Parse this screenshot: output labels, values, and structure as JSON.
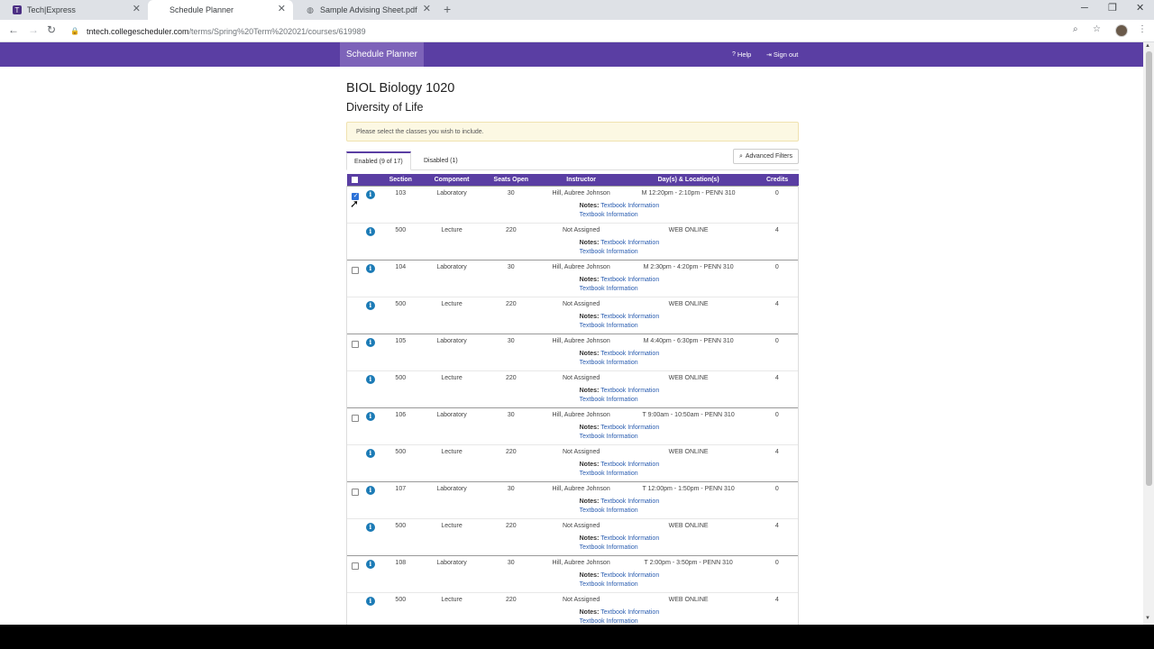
{
  "browser": {
    "tabs": [
      {
        "title": "Tech|Express",
        "active": false
      },
      {
        "title": "Schedule Planner",
        "active": true
      },
      {
        "title": "Sample Advising Sheet.pdf",
        "active": false
      }
    ],
    "url_host": "tntech.collegescheduler.com",
    "url_path": "/terms/Spring%20Term%202021/courses/619989"
  },
  "header": {
    "brand": "Schedule Planner",
    "help": "Help",
    "signout": "Sign out"
  },
  "course": {
    "title": "BIOL Biology 1020",
    "subtitle": "Diversity of Life",
    "notice": "Please select the classes you wish to include."
  },
  "tabs": {
    "enabled": "Enabled (9 of 17)",
    "disabled": "Disabled (1)",
    "advanced": "Advanced Filters"
  },
  "table": {
    "headers": {
      "section": "Section",
      "component": "Component",
      "seats": "Seats Open",
      "instructor": "Instructor",
      "days": "Day(s) & Location(s)",
      "credits": "Credits"
    },
    "notes_label": "Notes:",
    "textbook": "Textbook Information",
    "rows": [
      {
        "has_checkbox": true,
        "checked": true,
        "section": "103",
        "component": "Laboratory",
        "seats": "30",
        "instructor": "Hill, Aubree Johnson",
        "days": "M 12:20pm - 2:10pm - PENN 310",
        "credits": "0"
      },
      {
        "has_checkbox": false,
        "checked": false,
        "section": "500",
        "component": "Lecture",
        "seats": "220",
        "instructor": "Not Assigned",
        "days": "WEB ONLINE",
        "credits": "4"
      },
      {
        "has_checkbox": true,
        "checked": false,
        "section": "104",
        "component": "Laboratory",
        "seats": "30",
        "instructor": "Hill, Aubree Johnson",
        "days": "M 2:30pm - 4:20pm - PENN 310",
        "credits": "0"
      },
      {
        "has_checkbox": false,
        "checked": false,
        "section": "500",
        "component": "Lecture",
        "seats": "220",
        "instructor": "Not Assigned",
        "days": "WEB ONLINE",
        "credits": "4"
      },
      {
        "has_checkbox": true,
        "checked": false,
        "section": "105",
        "component": "Laboratory",
        "seats": "30",
        "instructor": "Hill, Aubree Johnson",
        "days": "M 4:40pm - 6:30pm - PENN 310",
        "credits": "0"
      },
      {
        "has_checkbox": false,
        "checked": false,
        "section": "500",
        "component": "Lecture",
        "seats": "220",
        "instructor": "Not Assigned",
        "days": "WEB ONLINE",
        "credits": "4"
      },
      {
        "has_checkbox": true,
        "checked": false,
        "section": "106",
        "component": "Laboratory",
        "seats": "30",
        "instructor": "Hill, Aubree Johnson",
        "days": "T 9:00am - 10:50am - PENN 310",
        "credits": "0"
      },
      {
        "has_checkbox": false,
        "checked": false,
        "section": "500",
        "component": "Lecture",
        "seats": "220",
        "instructor": "Not Assigned",
        "days": "WEB ONLINE",
        "credits": "4"
      },
      {
        "has_checkbox": true,
        "checked": false,
        "section": "107",
        "component": "Laboratory",
        "seats": "30",
        "instructor": "Hill, Aubree Johnson",
        "days": "T 12:00pm - 1:50pm - PENN 310",
        "credits": "0"
      },
      {
        "has_checkbox": false,
        "checked": false,
        "section": "500",
        "component": "Lecture",
        "seats": "220",
        "instructor": "Not Assigned",
        "days": "WEB ONLINE",
        "credits": "4"
      },
      {
        "has_checkbox": true,
        "checked": false,
        "section": "108",
        "component": "Laboratory",
        "seats": "30",
        "instructor": "Hill, Aubree Johnson",
        "days": "T 2:00pm - 3:50pm - PENN 310",
        "credits": "0"
      },
      {
        "has_checkbox": false,
        "checked": false,
        "section": "500",
        "component": "Lecture",
        "seats": "220",
        "instructor": "Not Assigned",
        "days": "WEB ONLINE",
        "credits": "4"
      }
    ]
  },
  "colors": {
    "brand_purple": "#5a3ea3",
    "brand_light": "#7d63b9",
    "info_blue": "#1c7bb6",
    "link_blue": "#2a5db0"
  }
}
